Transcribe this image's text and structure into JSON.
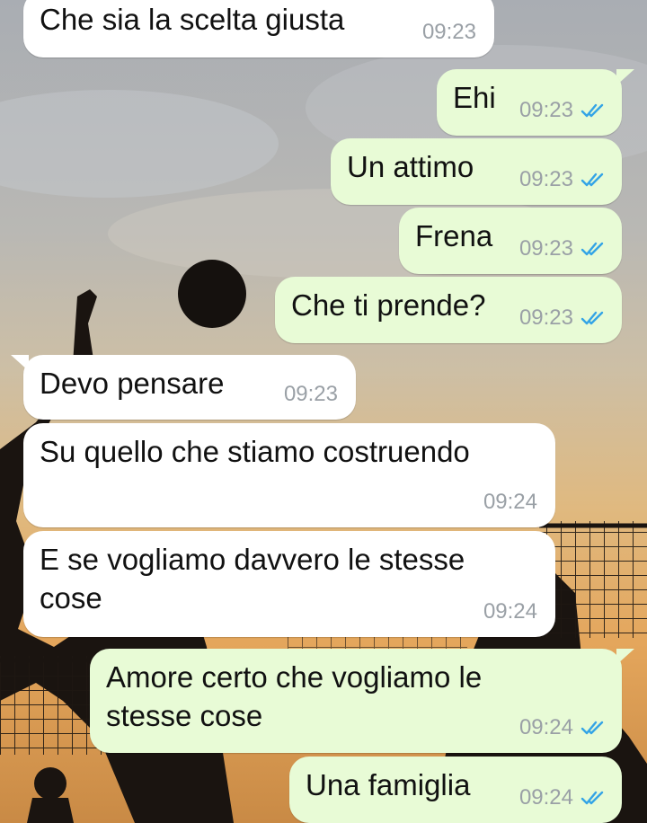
{
  "colors": {
    "incoming_bubble": "#ffffff",
    "outgoing_bubble": "#e8fbd6",
    "time": "#9aa0a6",
    "read_ticks": "#34a4e6"
  },
  "icons": {
    "read_receipt": "double-check-icon"
  },
  "messages": [
    {
      "direction": "incoming",
      "text": "Che sia la scelta giusta",
      "time": "09:23"
    },
    {
      "direction": "outgoing",
      "text": "Ehi",
      "time": "09:23",
      "status": "read"
    },
    {
      "direction": "outgoing",
      "text": "Un attimo",
      "time": "09:23",
      "status": "read"
    },
    {
      "direction": "outgoing",
      "text": "Frena",
      "time": "09:23",
      "status": "read"
    },
    {
      "direction": "outgoing",
      "text": "Che ti prende?",
      "time": "09:23",
      "status": "read"
    },
    {
      "direction": "incoming",
      "text": "Devo pensare",
      "time": "09:23"
    },
    {
      "direction": "incoming",
      "text": "Su quello che stiamo costruendo",
      "time": "09:24"
    },
    {
      "direction": "incoming",
      "text": "E se vogliamo davvero le stesse cose",
      "time": "09:24"
    },
    {
      "direction": "outgoing",
      "text": "Amore certo che vogliamo le stesse cose",
      "time": "09:24",
      "status": "read"
    },
    {
      "direction": "outgoing",
      "text": "Una famiglia",
      "time": "09:24",
      "status": "read"
    }
  ]
}
